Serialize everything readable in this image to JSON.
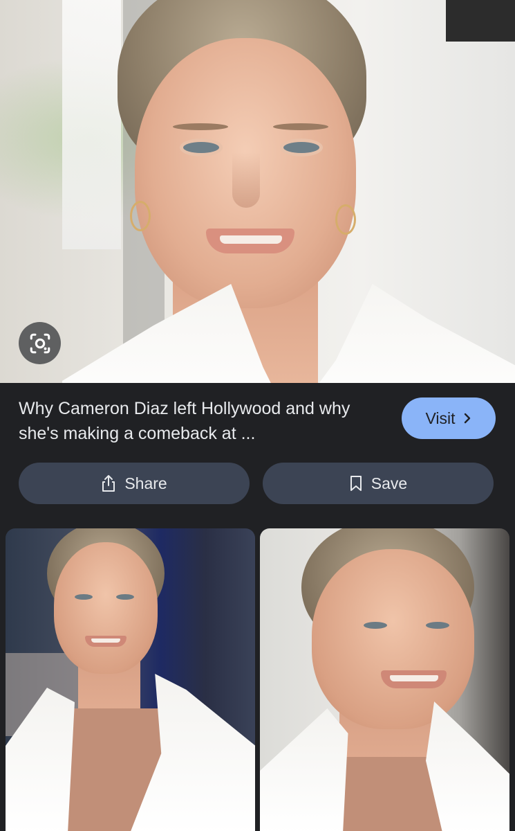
{
  "hero": {
    "image_subject": "Close-up portrait of Cameron Diaz smiling, hair pulled back, hoop earrings, white blazer",
    "lens_icon": "google-lens-icon"
  },
  "result": {
    "title": "Why Cameron Diaz left Hollywood and why she's making a comeback at ...",
    "visit_label": "Visit",
    "visit_icon": "chevron-right-icon"
  },
  "actions": {
    "share_label": "Share",
    "share_icon": "share-icon",
    "save_label": "Save",
    "save_icon": "bookmark-icon"
  },
  "related": [
    {
      "image_subject": "Cameron Diaz in white blazer and blush top, smiling, city background"
    },
    {
      "image_subject": "Cameron Diaz close-up smiling, hair pulled back, white blazer"
    }
  ],
  "colors": {
    "background": "#202124",
    "title_text": "#e8eaed",
    "visit_button": "#8ab4f8",
    "action_button": "#3c4454",
    "lens_button": "#5f6061"
  }
}
